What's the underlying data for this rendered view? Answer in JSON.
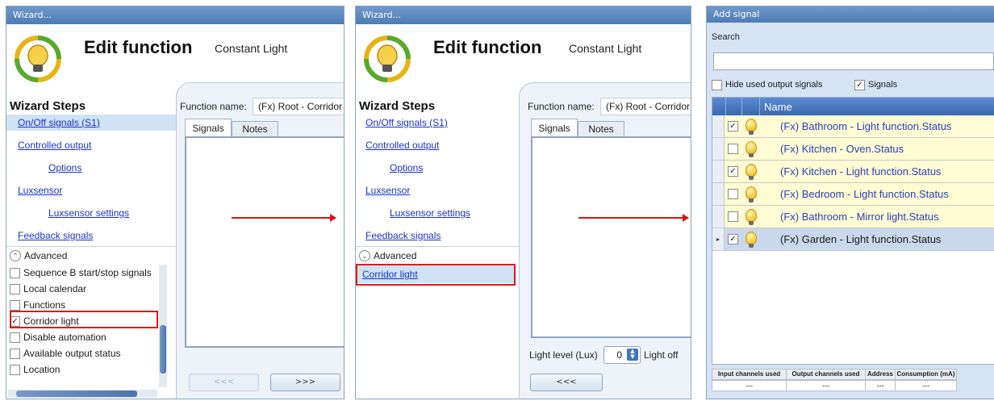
{
  "colors": {
    "link": "#1a33c8",
    "selected_row": "#c9d8ec",
    "highlight_box": "#e01a1a",
    "arrow": "#e01010",
    "bulb": "#f2c531"
  },
  "win1": {
    "title": "Wizard...",
    "header": {
      "title": "Edit function",
      "subtitle": "Constant Light"
    },
    "steps_title": "Wizard Steps",
    "steps": [
      "On/Off signals (S1)",
      "Controlled output",
      "Options",
      "Luxsensor",
      "Luxsensor settings",
      "Feedback signals"
    ],
    "advanced_label": "Advanced",
    "advanced_items": [
      {
        "label": "Sequence B start/stop signals",
        "checked": false
      },
      {
        "label": "Local calendar",
        "checked": false
      },
      {
        "label": "Functions",
        "checked": false
      },
      {
        "label": "Corridor light",
        "checked": true
      },
      {
        "label": "Disable automation",
        "checked": false
      },
      {
        "label": "Available output status",
        "checked": false
      },
      {
        "label": "Location",
        "checked": false
      }
    ],
    "function_name_label": "Function name:",
    "function_name_value": "(Fx) Root - Corridor",
    "tabs": [
      "Signals",
      "Notes"
    ],
    "back_label": "<<<",
    "next_label": ">>>"
  },
  "win2": {
    "title": "Wizard...",
    "header": {
      "title": "Edit function",
      "subtitle": "Constant Light"
    },
    "steps_title": "Wizard Steps",
    "steps": [
      "On/Off signals (S1)",
      "Controlled output",
      "Options",
      "Luxsensor",
      "Luxsensor settings",
      "Feedback signals"
    ],
    "advanced_label": "Advanced",
    "corridor_step": "Corridor light",
    "function_name_label": "Function name:",
    "function_name_value": "(Fx) Root - Corridor",
    "tabs": [
      "Signals",
      "Notes"
    ],
    "light_level_label": "Light level (Lux)",
    "light_level_value": "0",
    "light_off_label": "Light off",
    "back_label": "<<<"
  },
  "win3": {
    "title": "Add signal",
    "search_label": "Search",
    "search_value": "",
    "hide_used_label": "Hide used output signals",
    "hide_used_checked": false,
    "signals_label": "Signals",
    "signals_checked": true,
    "column_name": "Name",
    "rows": [
      {
        "name": "(Fx) Bathroom - Light function.Status",
        "checked": true
      },
      {
        "name": "(Fx) Kitchen - Oven.Status",
        "checked": false
      },
      {
        "name": "(Fx) Kitchen - Light function.Status",
        "checked": true
      },
      {
        "name": "(Fx) Bedroom - Light function.Status",
        "checked": false
      },
      {
        "name": "(Fx) Bathroom - Mirror light.Status",
        "checked": false
      },
      {
        "name": "(Fx) Garden - Light function.Status",
        "checked": true,
        "selected": true
      }
    ],
    "stats": {
      "headers": [
        "Input channels used",
        "Output channels used",
        "Address",
        "Consumption (mA)"
      ],
      "values": [
        "---",
        "---",
        "---",
        "---"
      ]
    }
  }
}
